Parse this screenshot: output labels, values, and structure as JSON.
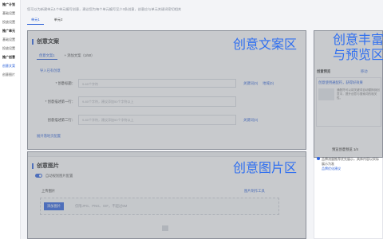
{
  "sidebar": {
    "items": [
      {
        "label": "推广计划"
      },
      {
        "label": "基础设置"
      },
      {
        "label": "投放设置"
      },
      {
        "label": "推广单元"
      },
      {
        "label": "基础设置"
      },
      {
        "label": "投放设置"
      },
      {
        "label": "推广创意"
      },
      {
        "label": "创意文案"
      },
      {
        "label": "创意图片"
      }
    ]
  },
  "hint": "您可以为新建单元1个单元编写创意，建议您为每个单元编写至少3条创意，创意应与单元关键词密切相关",
  "unit_tabs": [
    "单元1",
    "单元2"
  ],
  "copy_section": {
    "title": "创意文案",
    "big_label": "创意文案区",
    "tabs": [
      "创意文案1",
      "+ 添加文案（1/50）"
    ],
    "import_link": "导入已有创意",
    "rows": [
      {
        "label": "* 创意标题：",
        "placeholder": "9-60个字符",
        "actions": [
          "关键词(0)",
          "地域(0)"
        ]
      },
      {
        "label": "* 创意描述第一行：",
        "placeholder": "9-80个字符，建议添加50个字符以上",
        "actions": []
      },
      {
        "label": "创意描述第二行：",
        "placeholder": "9-80个字符，建议添加50个字符以上",
        "actions": [
          "关键词(0)"
        ]
      }
    ],
    "expand_link": "展开落地页配置"
  },
  "image_section": {
    "title": "创意图片",
    "big_label": "创意图片区",
    "toggle_label": "自动规划图片配置",
    "upload_label": "上传图片",
    "tool_link": "图片制作工具",
    "upload_button": "添加图片",
    "upload_hint": "仅限JPG、PNG、GIF，不超过5M"
  },
  "preview": {
    "big_label_line1": "创意丰富",
    "big_label_line2": "与预览区",
    "header": "创意预览",
    "header_link": "移动",
    "card_title": "创意使用通配符，获得好效果",
    "card_text": "通配符可以将关键词自动替换到创意中，提升创意与搜索词的相关性。",
    "pager": "预览创意预览 1/4",
    "tip": "品牌流量推荐优先展示，具体内容以实际展示为准",
    "tip_link": "品牌优化建议"
  }
}
